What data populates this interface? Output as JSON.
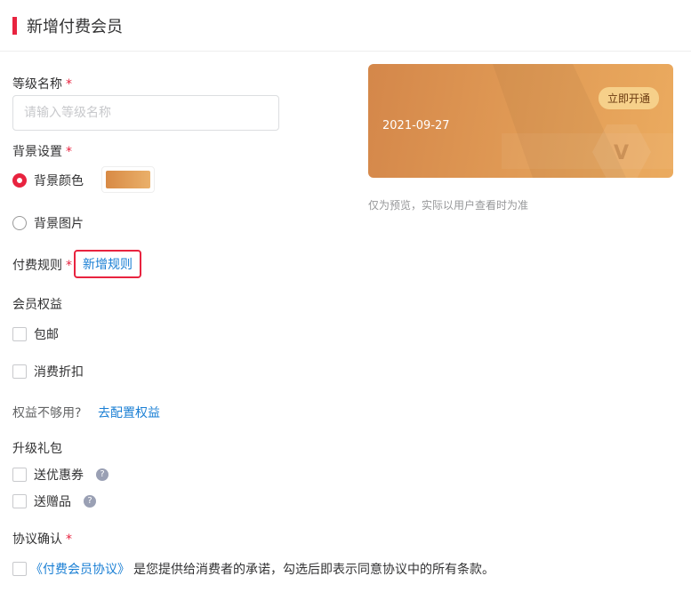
{
  "header": {
    "title": "新增付费会员"
  },
  "form": {
    "level_name": {
      "label": "等级名称",
      "required": "*",
      "placeholder": "请输入等级名称",
      "value": ""
    },
    "background": {
      "label": "背景设置",
      "required": "*",
      "options": [
        {
          "label": "背景颜色",
          "selected": true
        },
        {
          "label": "背景图片",
          "selected": false
        }
      ],
      "color": "#e09a55"
    },
    "pay_rule": {
      "label": "付费规则",
      "required": "*",
      "add_label": "新增规则"
    },
    "benefits": {
      "label": "会员权益",
      "items": [
        {
          "label": "包邮",
          "checked": false
        },
        {
          "label": "消费折扣",
          "checked": false
        }
      ],
      "hint": "权益不够用?",
      "config_link": "去配置权益"
    },
    "gift": {
      "label": "升级礼包",
      "items": [
        {
          "label": "送优惠券",
          "checked": false,
          "help": "?"
        },
        {
          "label": "送赠品",
          "checked": false,
          "help": "?"
        }
      ]
    },
    "agreement": {
      "label": "协议确认",
      "required": "*",
      "link": "《付费会员协议》",
      "text": "是您提供给消费者的承诺，勾选后即表示同意协议中的所有条款。",
      "checked": false
    }
  },
  "preview": {
    "date": "2021-09-27",
    "button": "立即开通",
    "badge": "V",
    "note": "仅为预览，实际以用户查看时为准"
  },
  "colors": {
    "accent": "#e8233f",
    "link": "#1a7fd4"
  }
}
